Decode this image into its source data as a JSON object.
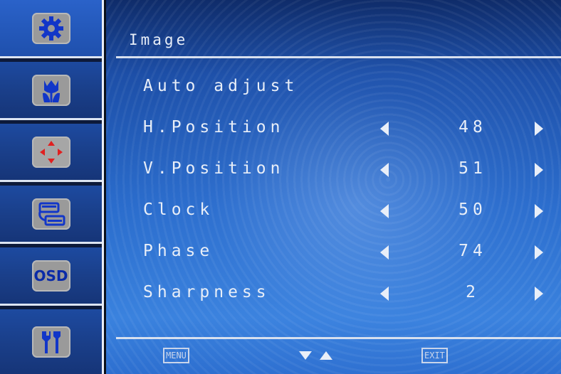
{
  "sidebar": {
    "items": [
      {
        "icon": "gear-icon",
        "active": true
      },
      {
        "icon": "flower-icon",
        "active": false
      },
      {
        "icon": "position-arrows-icon",
        "active": false
      },
      {
        "icon": "input-connector-icon",
        "active": false
      },
      {
        "icon": "osd-icon",
        "label": "OSD",
        "active": false
      },
      {
        "icon": "tools-icon",
        "active": false
      }
    ]
  },
  "menu": {
    "title": "Image",
    "items": [
      {
        "label": "Auto adjust",
        "value": ""
      },
      {
        "label": "H.Position",
        "value": "48"
      },
      {
        "label": "V.Position",
        "value": "51"
      },
      {
        "label": "Clock",
        "value": "50"
      },
      {
        "label": "Phase",
        "value": "74"
      },
      {
        "label": "Sharpness",
        "value": "2"
      }
    ]
  },
  "footer": {
    "menu_label": "MENU",
    "exit_label": "EXIT"
  },
  "colors": {
    "accent_blue": "#1d4fa8",
    "text": "#e8eef8",
    "icon_bg": "#9a9a9a"
  }
}
